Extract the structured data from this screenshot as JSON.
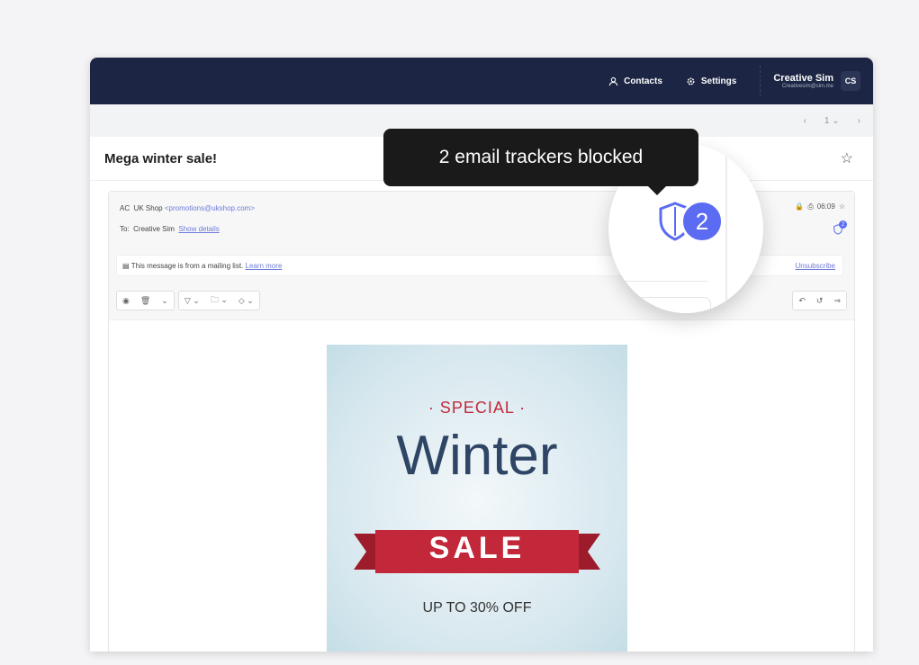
{
  "header": {
    "contacts_label": "Contacts",
    "settings_label": "Settings",
    "user_name": "Creative Sim",
    "user_email": "Creativesim@sim.me",
    "avatar_initials": "CS"
  },
  "pager": {
    "page": "1"
  },
  "subject": "Mega winter sale!",
  "message": {
    "sender_initials": "AC",
    "sender_name": "UK Shop",
    "sender_email": "<promotions@ukshop.com>",
    "to_label": "To:",
    "to_name": "Creative Sim",
    "show_details": "Show details",
    "time": "06:09",
    "tracker_count_small": "2",
    "mailing_list_text": "This message is from a mailing list.",
    "learn_more": "Learn more",
    "unsubscribe": "Unsubscribe"
  },
  "banner": {
    "special": "· SPECIAL ·",
    "title": "Winter",
    "sale": "SALE",
    "offer": "UP TO 30% OFF"
  },
  "tooltip": {
    "text": "2 email trackers blocked",
    "badge_count": "2"
  },
  "colors": {
    "topbar": "#1c2543",
    "accent": "#5b6cf2",
    "sale_red": "#c2283a",
    "tooltip_bg": "#1a1a1a"
  }
}
